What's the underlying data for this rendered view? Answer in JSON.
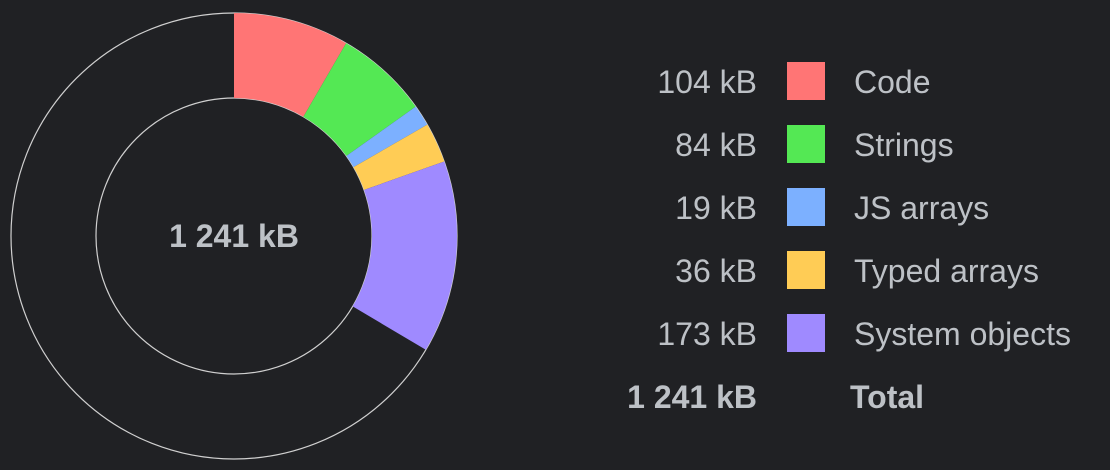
{
  "chart_data": {
    "type": "pie",
    "donut": true,
    "center_label": "1 241 kB",
    "total": {
      "value": 1241,
      "value_label": "1 241 kB",
      "label": "Total"
    },
    "unit": "kB",
    "slices": [
      {
        "label": "Code",
        "value": 104,
        "value_label": "104 kB",
        "color": "#ff7575"
      },
      {
        "label": "Strings",
        "value": 84,
        "value_label": "84 kB",
        "color": "#54e854"
      },
      {
        "label": "JS arrays",
        "value": 19,
        "value_label": "19 kB",
        "color": "#7cb0ff"
      },
      {
        "label": "Typed arrays",
        "value": 36,
        "value_label": "36 kB",
        "color": "#ffcc55"
      },
      {
        "label": "System objects",
        "value": 173,
        "value_label": "173 kB",
        "color": "#9f8aff"
      }
    ]
  },
  "colors": {
    "background": "#202124",
    "text": "#bdc1c6",
    "ring_outline": "#d0d0d0"
  }
}
